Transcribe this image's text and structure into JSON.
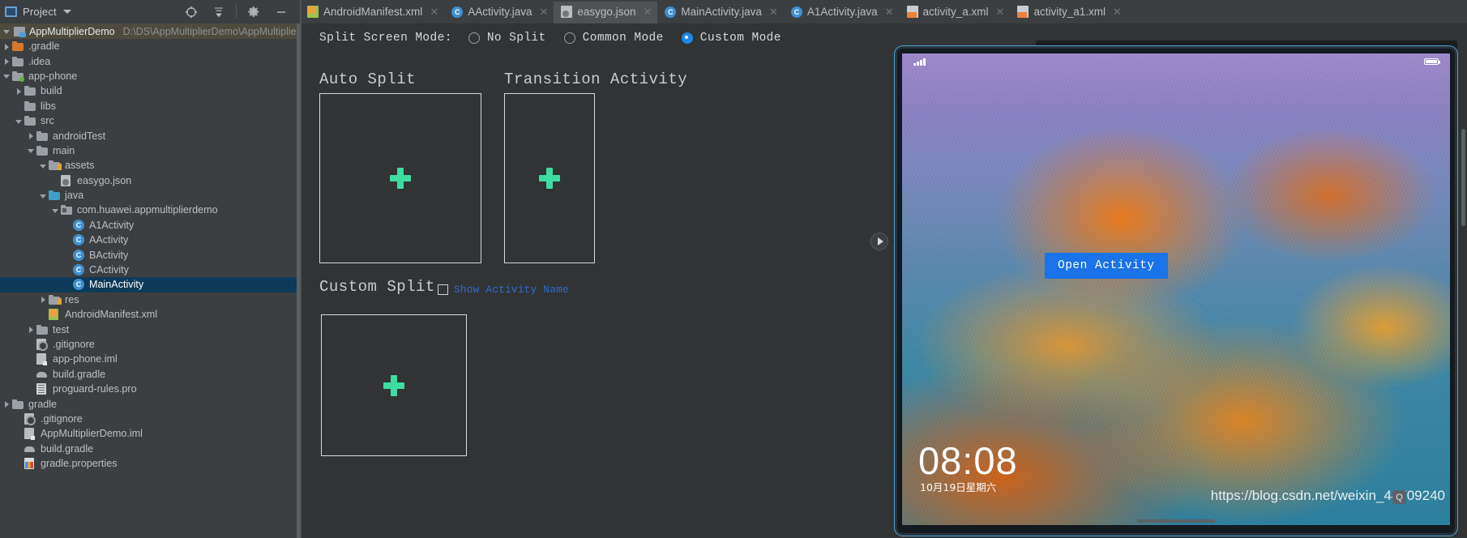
{
  "toolbar": {
    "project_label": "Project",
    "icons": [
      "target-icon",
      "collapse-all-icon",
      "gear-icon",
      "minimize-icon"
    ]
  },
  "tabs": [
    {
      "label": "AndroidManifest.xml",
      "icon": "manifest-file-icon",
      "active": false
    },
    {
      "label": "AActivity.java",
      "icon": "java-class-icon",
      "active": false
    },
    {
      "label": "easygo.json",
      "icon": "json-file-icon",
      "active": true
    },
    {
      "label": "MainActivity.java",
      "icon": "java-class-icon",
      "active": false
    },
    {
      "label": "A1Activity.java",
      "icon": "java-class-icon",
      "active": false
    },
    {
      "label": "activity_a.xml",
      "icon": "xml-layout-icon",
      "active": false
    },
    {
      "label": "activity_a1.xml",
      "icon": "xml-layout-icon",
      "active": false
    }
  ],
  "project_header": {
    "name": "AppMultiplierDemo",
    "path": "D:\\DS\\AppMultiplierDemo\\AppMultiplierDemo"
  },
  "tree": [
    {
      "label": ".gradle",
      "indent": 1,
      "twisty": "right",
      "icon": "folder-orange-icon",
      "selected": false
    },
    {
      "label": ".idea",
      "indent": 1,
      "twisty": "right",
      "icon": "folder-icon",
      "selected": false
    },
    {
      "label": "app-phone",
      "indent": 1,
      "twisty": "down",
      "icon": "module-folder-icon",
      "selected": false
    },
    {
      "label": "build",
      "indent": 2,
      "twisty": "right",
      "icon": "folder-icon",
      "selected": false
    },
    {
      "label": "libs",
      "indent": 2,
      "twisty": "none",
      "icon": "folder-icon",
      "selected": false
    },
    {
      "label": "src",
      "indent": 2,
      "twisty": "down",
      "icon": "folder-icon",
      "selected": false
    },
    {
      "label": "androidTest",
      "indent": 3,
      "twisty": "right",
      "icon": "folder-icon",
      "selected": false
    },
    {
      "label": "main",
      "indent": 3,
      "twisty": "down",
      "icon": "folder-icon",
      "selected": false
    },
    {
      "label": "assets",
      "indent": 4,
      "twisty": "down",
      "icon": "assets-folder-icon",
      "selected": false
    },
    {
      "label": "easygo.json",
      "indent": 5,
      "twisty": "none",
      "icon": "json-file-icon",
      "selected": false
    },
    {
      "label": "java",
      "indent": 4,
      "twisty": "down",
      "icon": "folder-blue-icon",
      "selected": false
    },
    {
      "label": "com.huawei.appmultiplierdemo",
      "indent": 5,
      "twisty": "down",
      "icon": "package-icon",
      "selected": false
    },
    {
      "label": "A1Activity",
      "indent": 6,
      "twisty": "none",
      "icon": "java-class-icon",
      "selected": false
    },
    {
      "label": "AActivity",
      "indent": 6,
      "twisty": "none",
      "icon": "java-class-icon",
      "selected": false
    },
    {
      "label": "BActivity",
      "indent": 6,
      "twisty": "none",
      "icon": "java-class-icon",
      "selected": false
    },
    {
      "label": "CActivity",
      "indent": 6,
      "twisty": "none",
      "icon": "java-class-icon",
      "selected": false
    },
    {
      "label": "MainActivity",
      "indent": 6,
      "twisty": "none",
      "icon": "java-class-icon",
      "selected": true
    },
    {
      "label": "res",
      "indent": 4,
      "twisty": "right",
      "icon": "res-folder-icon",
      "selected": false
    },
    {
      "label": "AndroidManifest.xml",
      "indent": 4,
      "twisty": "none",
      "icon": "manifest-file-icon",
      "selected": false
    },
    {
      "label": "test",
      "indent": 3,
      "twisty": "right",
      "icon": "folder-icon",
      "selected": false
    },
    {
      "label": ".gitignore",
      "indent": 3,
      "twisty": "none",
      "icon": "gitignore-icon",
      "selected": false
    },
    {
      "label": "app-phone.iml",
      "indent": 3,
      "twisty": "none",
      "icon": "iml-file-icon",
      "selected": false
    },
    {
      "label": "build.gradle",
      "indent": 3,
      "twisty": "none",
      "icon": "gradle-file-icon",
      "selected": false
    },
    {
      "label": "proguard-rules.pro",
      "indent": 3,
      "twisty": "none",
      "icon": "pro-file-icon",
      "selected": false
    },
    {
      "label": "gradle",
      "indent": 1,
      "twisty": "right",
      "icon": "folder-icon",
      "selected": false
    },
    {
      "label": ".gitignore",
      "indent": 2,
      "twisty": "none",
      "icon": "gitignore-icon",
      "selected": false
    },
    {
      "label": "AppMultiplierDemo.iml",
      "indent": 2,
      "twisty": "none",
      "icon": "iml-file-icon",
      "selected": false
    },
    {
      "label": "build.gradle",
      "indent": 2,
      "twisty": "none",
      "icon": "gradle-file-icon",
      "selected": false
    },
    {
      "label": "gradle.properties",
      "indent": 2,
      "twisty": "none",
      "icon": "properties-file-icon",
      "selected": false
    }
  ],
  "mode_bar": {
    "label": "Split Screen Mode:",
    "options": [
      {
        "label": "No Split",
        "selected": false
      },
      {
        "label": "Common Mode",
        "selected": false
      },
      {
        "label": "Custom Mode",
        "selected": true
      }
    ]
  },
  "canvas": {
    "sections": [
      {
        "title": "Auto Split",
        "placeholder": "add-view-placeholder"
      },
      {
        "title": "Transition Activity",
        "placeholder": "add-view-placeholder"
      },
      {
        "title": "Custom Split",
        "placeholder": "add-view-placeholder"
      }
    ],
    "checkbox": {
      "label": "Show Activity Name",
      "checked": false
    }
  },
  "preview": {
    "button_label": "Open Activity",
    "lock_time": "08:08",
    "lock_date": "10月19日星期六",
    "watermark": "https://blog.csdn.net/weixin_44709240",
    "watermark_badge": "Q"
  },
  "colors": {
    "accent_blue": "#1a73e8",
    "selection_blue": "#0d3a58",
    "plus_green": "#3ddca0",
    "link_blue": "#2f6fd0"
  }
}
